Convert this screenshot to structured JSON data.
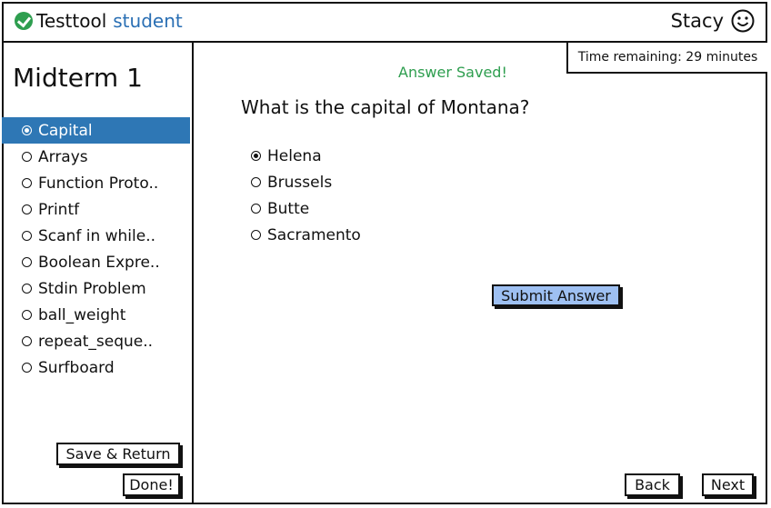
{
  "header": {
    "brand_name": "Testtool",
    "brand_accent": "student",
    "user_name": "Stacy"
  },
  "colors": {
    "accent_blue": "#2a6fb4",
    "selection_blue": "#2e77b5",
    "success_green": "#2e9e4f",
    "submit_button": "#9ec0f2"
  },
  "sidebar": {
    "exam_title": "Midterm 1",
    "questions": [
      {
        "label": "Capital",
        "selected": true
      },
      {
        "label": "Arrays",
        "selected": false
      },
      {
        "label": "Function Proto..",
        "selected": false
      },
      {
        "label": "Printf",
        "selected": false
      },
      {
        "label": "Scanf in while..",
        "selected": false
      },
      {
        "label": "Boolean Expre..",
        "selected": false
      },
      {
        "label": "Stdin Problem",
        "selected": false
      },
      {
        "label": "ball_weight",
        "selected": false
      },
      {
        "label": "repeat_seque..",
        "selected": false
      },
      {
        "label": "Surfboard",
        "selected": false
      }
    ],
    "save_return_label": "Save & Return",
    "done_label": "Done!"
  },
  "main": {
    "timer_text": "Time remaining: 29 minutes",
    "status_text": "Answer Saved!",
    "question_text": "What is the capital of Montana?",
    "options": [
      {
        "label": "Helena",
        "selected": true
      },
      {
        "label": "Brussels",
        "selected": false
      },
      {
        "label": "Butte",
        "selected": false
      },
      {
        "label": "Sacramento",
        "selected": false
      }
    ],
    "submit_label": "Submit Answer",
    "back_label": "Back",
    "next_label": "Next"
  }
}
